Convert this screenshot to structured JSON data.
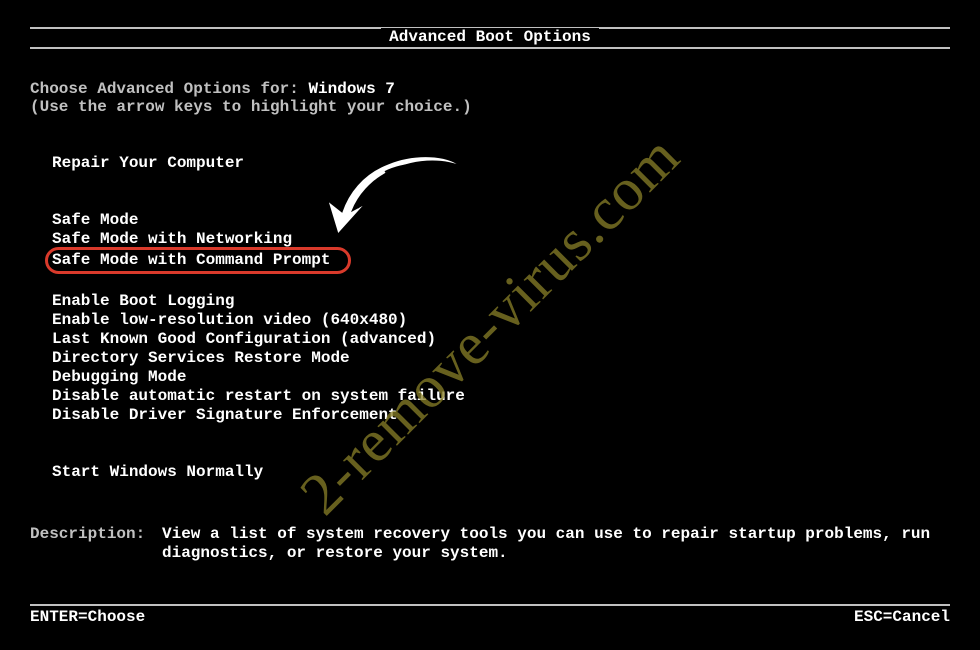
{
  "title": "Advanced Boot Options",
  "choose_prefix": "Choose Advanced Options for: ",
  "os_name": "Windows 7",
  "hint": "(Use the arrow keys to highlight your choice.)",
  "menu": {
    "group1": [
      "Repair Your Computer"
    ],
    "group2": [
      "Safe Mode",
      "Safe Mode with Networking",
      "Safe Mode with Command Prompt"
    ],
    "group3": [
      "Enable Boot Logging",
      "Enable low-resolution video (640x480)",
      "Last Known Good Configuration (advanced)",
      "Directory Services Restore Mode",
      "Debugging Mode",
      "Disable automatic restart on system failure",
      "Disable Driver Signature Enforcement"
    ],
    "group4": [
      "Start Windows Normally"
    ]
  },
  "description": {
    "label": "Description:",
    "text": "View a list of system recovery tools you can use to repair startup problems, run diagnostics, or restore your system."
  },
  "footer": {
    "left": "ENTER=Choose",
    "right": "ESC=Cancel"
  },
  "watermark": "2-remove-virus.com"
}
